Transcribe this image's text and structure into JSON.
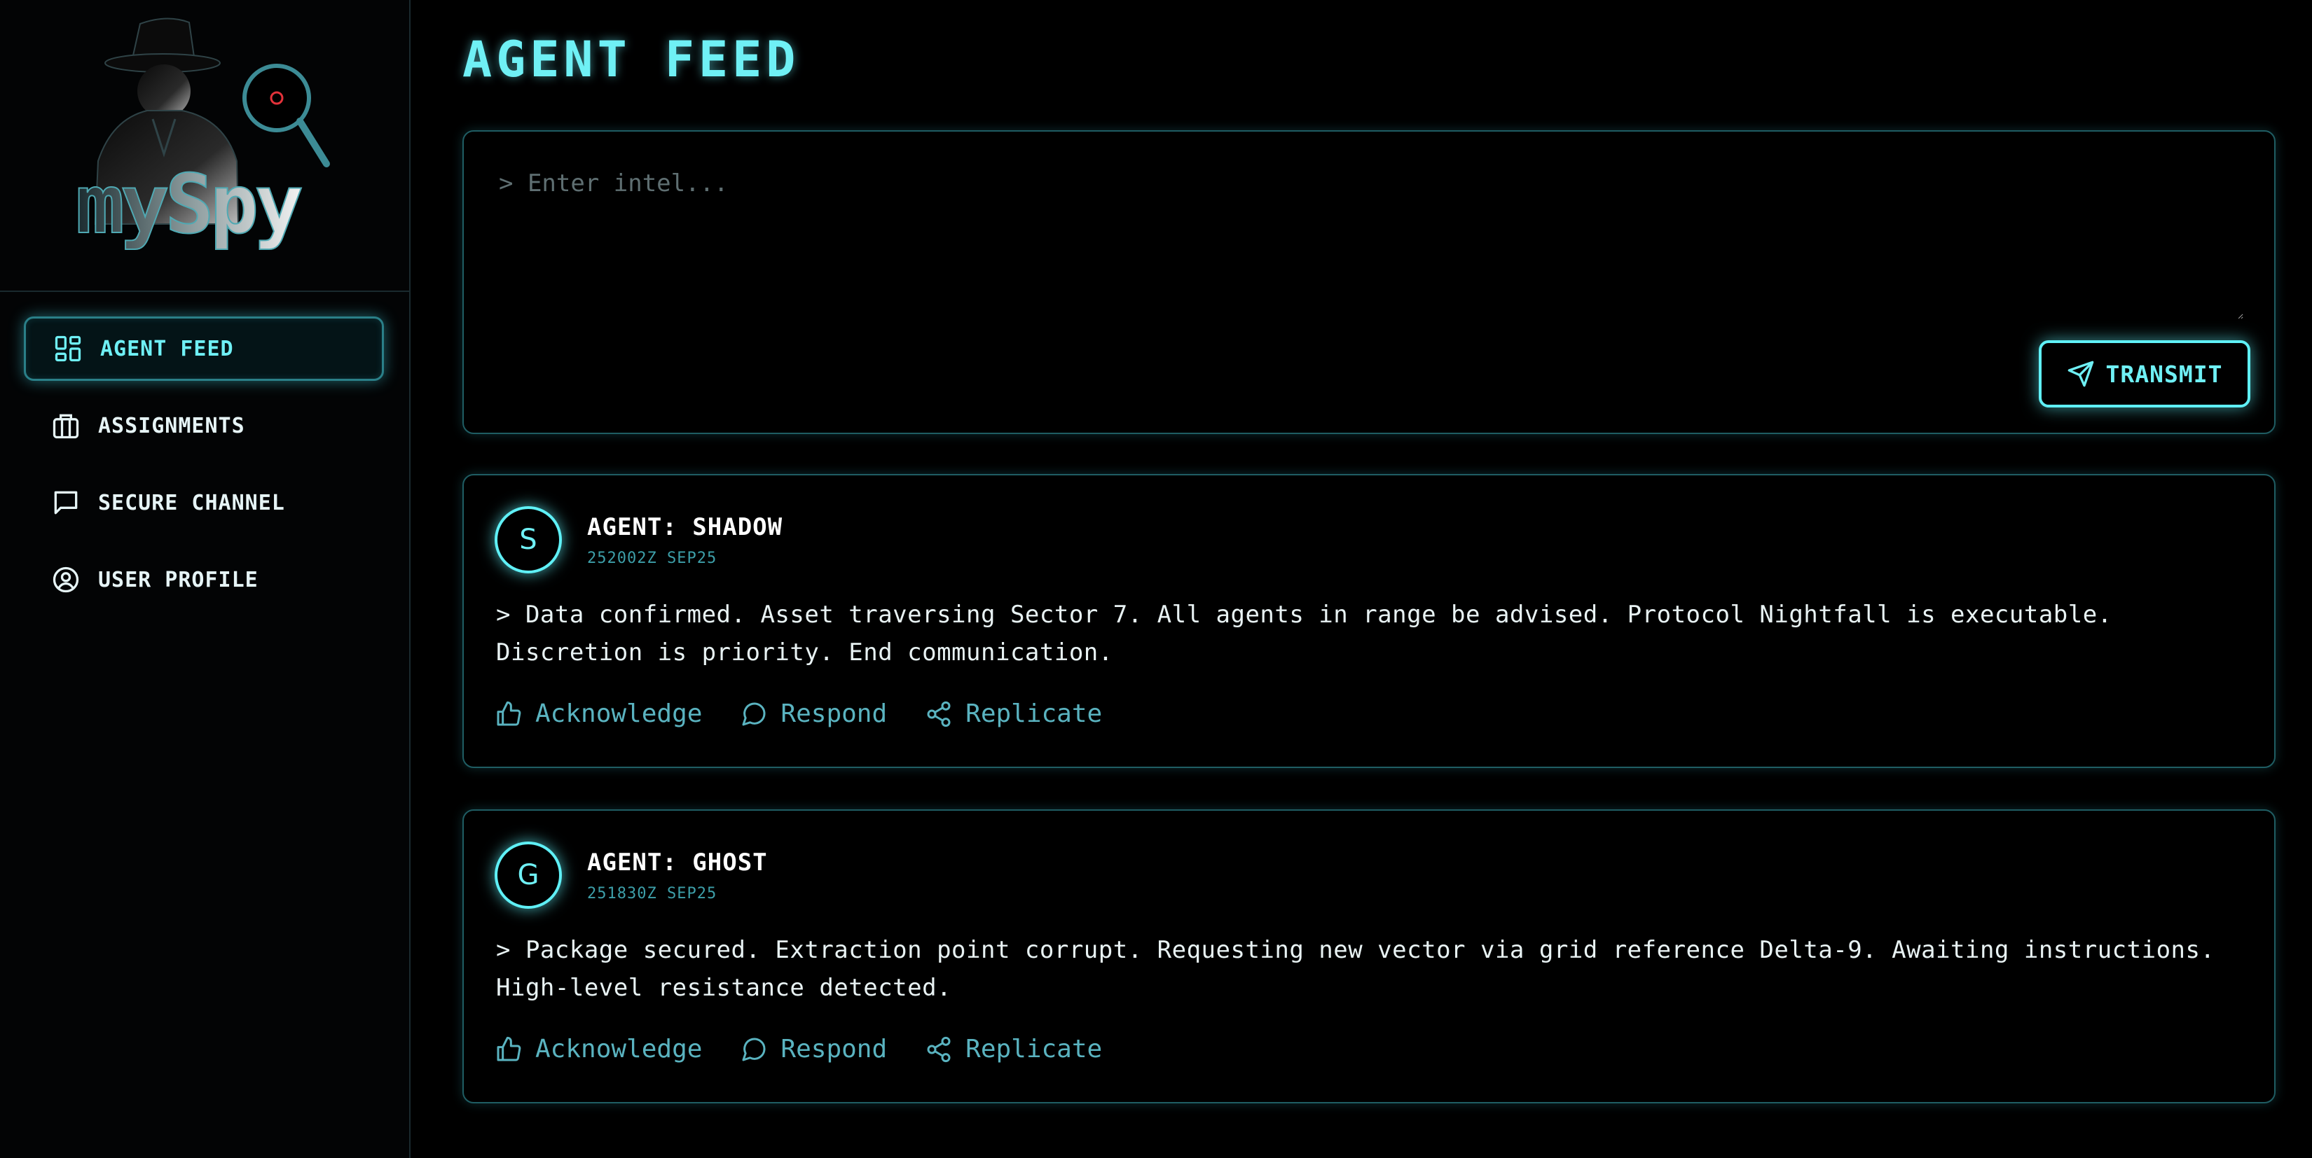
{
  "app": {
    "logo_text": "mySpy"
  },
  "sidebar": {
    "items": [
      {
        "label": "AGENT FEED",
        "icon": "dashboard-icon",
        "active": true
      },
      {
        "label": "ASSIGNMENTS",
        "icon": "briefcase-icon",
        "active": false
      },
      {
        "label": "SECURE CHANNEL",
        "icon": "chat-icon",
        "active": false
      },
      {
        "label": "USER PROFILE",
        "icon": "user-circle-icon",
        "active": false
      }
    ]
  },
  "main": {
    "title": "AGENT FEED",
    "composer": {
      "placeholder": "> Enter intel...",
      "value": "",
      "submit_label": "TRANSMIT",
      "submit_icon": "send-icon"
    },
    "posts": [
      {
        "avatar_letter": "S",
        "author": "AGENT: SHADOW",
        "timestamp": "252002Z SEP25",
        "body": "> Data confirmed. Asset traversing Sector 7. All agents in range be advised. Protocol Nightfall is executable. Discretion is priority. End communication."
      },
      {
        "avatar_letter": "G",
        "author": "AGENT: GHOST",
        "timestamp": "251830Z SEP25",
        "body": "> Package secured. Extraction point corrupt. Requesting new vector via grid reference Delta-9. Awaiting instructions. High-level resistance detected."
      }
    ],
    "post_actions": {
      "acknowledge": "Acknowledge",
      "respond": "Respond",
      "replicate": "Replicate"
    }
  },
  "colors": {
    "accent": "#6ff0f5",
    "border": "#1f5d63",
    "action": "#5ab3c0",
    "timestamp": "#3d9fa9",
    "background": "#000000"
  }
}
